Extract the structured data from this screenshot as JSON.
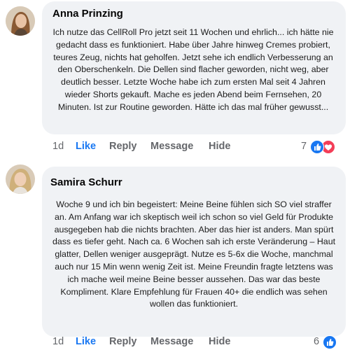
{
  "comments": [
    {
      "author": "Anna Prinzing",
      "text": "Ich nutze das CellRoll Pro jetzt seit 11 Wochen und ehrlich... ich hätte nie gedacht dass es funktioniert. Habe über Jahre hinweg Cremes probiert, teures Zeug, nichts hat geholfen. Jetzt sehe ich endlich Verbesserung an den Oberschenkeln. Die Dellen sind flacher geworden, nicht weg, aber deutlich besser. Letzte Woche habe ich zum ersten Mal seit 4 Jahren wieder Shorts gekauft. Mache es jeden Abend beim Fernsehen, 20 Minuten. Ist zur Routine geworden. Hätte ich das mal früher gewusst...",
      "time": "1d",
      "like_label": "Like",
      "reply_label": "Reply",
      "message_label": "Message",
      "hide_label": "Hide",
      "reaction_count": "7",
      "reactions": [
        "like-reaction-icon",
        "love-reaction-icon"
      ]
    },
    {
      "author": "Samira Schurr",
      "text": "Woche 9 und ich bin begeistert: Meine Beine fühlen sich SO viel straffer an. Am Anfang war ich skeptisch weil ich schon so viel Geld für Produkte ausgegeben hab die nichts brachten. Aber das hier ist anders. Man spürt dass es tiefer geht. Nach ca. 6 Wochen sah ich erste Veränderung – Haut glatter, Dellen weniger ausgeprägt. Nutze es 5-6x die Woche, manchmal auch nur 15 Min wenn wenig Zeit ist. Meine Freundin fragte letztens was ich mache weil meine Beine besser aussehen. Das war das beste Kompliment. Klare Empfehlung für Frauen 40+ die endlich was sehen wollen das funktioniert.",
      "time": "1d",
      "like_label": "Like",
      "reply_label": "Reply",
      "message_label": "Message",
      "hide_label": "Hide",
      "reaction_count": "6",
      "reactions": [
        "like-reaction-icon"
      ]
    }
  ],
  "colors": {
    "bubble": "#f0f2f5",
    "like_blue": "#1877f2",
    "meta_gray": "#65676b",
    "love_red": "#f33e58"
  }
}
